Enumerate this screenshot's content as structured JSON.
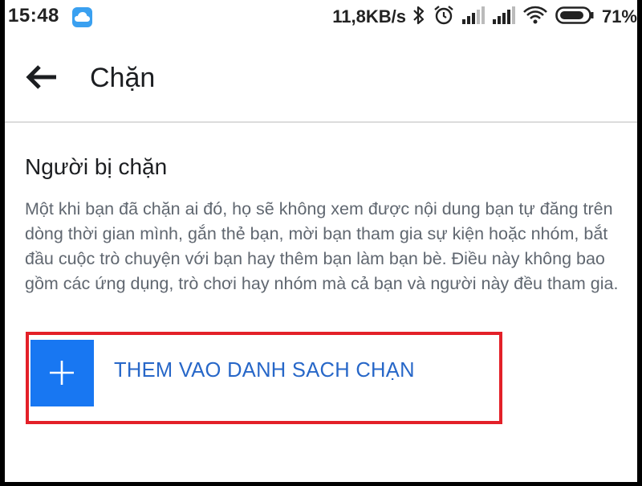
{
  "status_bar": {
    "time": "15:48",
    "net_speed": "11,8KB/s",
    "battery": "71%",
    "icons": [
      "cloud-icon",
      "bluetooth-icon",
      "alarm-icon",
      "signal-icon",
      "signal-icon",
      "wifi-icon",
      "battery-icon"
    ]
  },
  "app_bar": {
    "back_icon": "arrow-left-icon",
    "title": "Chặn"
  },
  "blocked": {
    "title": "Người bị chặn",
    "description": "Một khi bạn đã chặn ai đó, họ sẽ không xem được nội dung bạn tự đăng trên dòng thời gian mình, gắn thẻ bạn, mời bạn tham gia sự kiện hoặc nhóm, bắt đầu cuộc trò chuyện với bạn hay thêm bạn làm bạn bè. Điều này không bao gồm các ứng dụng, trò chơi hay nhóm mà cả bạn và người này đều tham gia.",
    "add_label": "THEM VAO DANH SACH CHẠN",
    "add_icon": "plus-icon"
  },
  "colors": {
    "accent": "#1877f2",
    "link_text": "#2767c8",
    "highlight_border": "#e32028",
    "body_text": "#606770"
  }
}
